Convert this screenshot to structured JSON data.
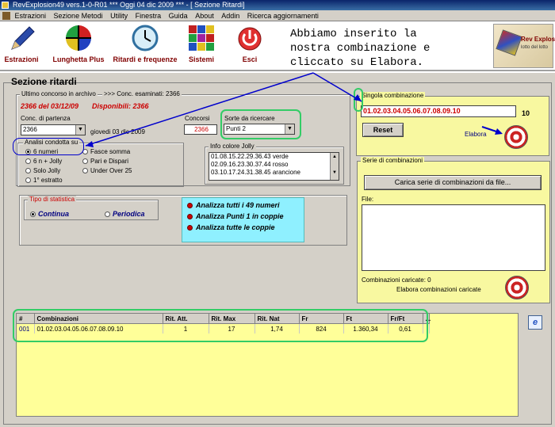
{
  "window": {
    "title": "RevExplosion49 vers.1-0-R01   ***   Oggi 04 dic 2009   ***   - [ Sezione Ritardi]"
  },
  "menu": [
    "Estrazioni",
    "Sezione Metodi",
    "Utility",
    "Finestra",
    "Guida",
    "About",
    "Addin",
    "Ricerca aggiornamenti"
  ],
  "toolbar": {
    "estrazioni": "Estrazioni",
    "lunghetta": "Lunghetta Plus",
    "ritardi": "Ritardi e frequenze",
    "sistemi": "Sistemi",
    "esci": "Esci"
  },
  "annotation": "Abbiamo inserito la\nnostra combinazione e\ncliccato su Elabora.",
  "logo": {
    "text": "Rev Explosion",
    "sub": "lotto del lotto"
  },
  "section": {
    "title": "Sezione ritardi"
  },
  "archive": {
    "group_label": "Ultimo concorso in archivo",
    "examined": ">>> Conc. esaminati: 2366",
    "last_draw": "2366 del 03/12/09",
    "available": "Disponibili: 2366"
  },
  "start": {
    "label": "Conc. di partenza",
    "value": "2366",
    "date": "giovedi 03 dic 2009"
  },
  "concorsi": {
    "label": "Concorsi",
    "value": "2366"
  },
  "sorte": {
    "label": "Sorte da ricercare",
    "value": "Punti 2"
  },
  "analisi": {
    "label": "Analisi condotta su",
    "options": [
      "6 numeri",
      "6 n + Jolly",
      "Solo Jolly",
      "1° estratto"
    ],
    "options2": [
      "Fasce somma",
      "Pari e Dispari",
      "Under Over 25"
    ],
    "selected": "6 numeri"
  },
  "jolly": {
    "label": "Info colore Jolly",
    "items": [
      "01.08.15.22.29.36.43 verde",
      "02.09.16.23.30.37.44 rosso",
      "03.10.17.24.31.38.45 arancione"
    ]
  },
  "statistica": {
    "label": "Tipo di statistica",
    "options": [
      "Continua",
      "Periodica"
    ],
    "selected": "Continua"
  },
  "actions": [
    "Analizza tutti i 49 numeri",
    "Analizza Punti 1 in coppie",
    "Analizza tutte le coppie"
  ],
  "singola": {
    "label": "Singola combinazione",
    "value": "01.02.03.04.05.06.07.08.09.10",
    "count": "10",
    "reset": "Reset",
    "elabora": "Elabora"
  },
  "serie": {
    "label": "Serie di combinazioni",
    "load_button": "Carica serie di combinazioni da file...",
    "file_label": "File:",
    "loaded": "Combinazioni caricate: 0",
    "elabora_loaded": "Elabora combinazioni caricate"
  },
  "results": {
    "columns": [
      "#",
      "Combinazioni",
      "Rit. Att.",
      "Rit. Max",
      "Rit. Nat",
      "Fr",
      "Ft",
      "Fr/Ft",
      "..."
    ],
    "rows": [
      [
        "001",
        "01.02.03.04.05.06.07.08.09.10",
        "1",
        "17",
        "1,74",
        "824",
        "1.360,34",
        "0,61",
        ""
      ]
    ]
  },
  "colors": {
    "accent_red": "#cc0000",
    "highlight_green": "#33cc66",
    "arrow_blue": "#0000cc",
    "panel_yellow": "#ffff99",
    "action_cyan": "#8ff0ff"
  }
}
